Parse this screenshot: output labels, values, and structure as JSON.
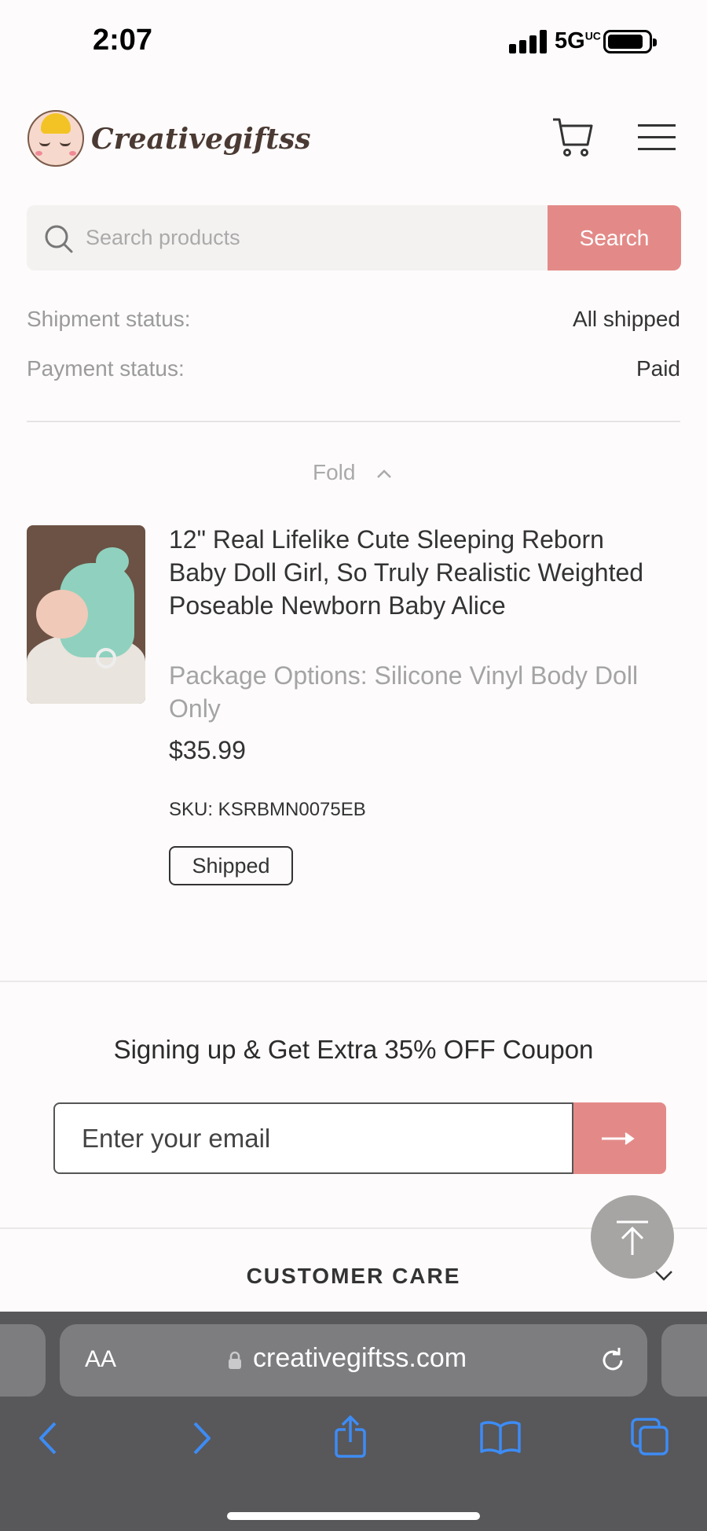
{
  "status_bar": {
    "time": "2:07",
    "network": "5G",
    "network_sup": "UC"
  },
  "header": {
    "logo_text": "Creativegiftss"
  },
  "search": {
    "placeholder": "Search products",
    "button_label": "Search"
  },
  "order_status": {
    "shipment_label": "Shipment status:",
    "shipment_value": "All shipped",
    "payment_label": "Payment status:",
    "payment_value": "Paid"
  },
  "fold_label": "Fold",
  "product": {
    "title": "12\" Real Lifelike Cute Sleeping Reborn Baby Doll Girl, So Truly Realistic Weighted Poseable Newborn Baby Alice",
    "option": "Package Options: Silicone Vinyl Body Doll Only",
    "price": "$35.99",
    "sku": "SKU: KSRBMN0075EB",
    "status_badge": "Shipped"
  },
  "newsletter": {
    "title": "Signing up & Get Extra 35% OFF Coupon",
    "email_placeholder": "Enter your email"
  },
  "footer": {
    "customer_care": "CUSTOMER CARE"
  },
  "browser": {
    "aa_label": "AA",
    "url": "creativegiftss.com"
  },
  "colors": {
    "accent": "#e38a88",
    "browser_bar": "#58575a",
    "nav_icon": "#3d8cf5"
  },
  "icons": [
    "search-icon",
    "cart-icon",
    "menu-icon",
    "chevron-up-icon",
    "arrow-right-icon",
    "arrow-up-icon",
    "chevron-down-icon",
    "lock-icon",
    "reload-icon",
    "back-icon",
    "forward-icon",
    "share-icon",
    "bookmarks-icon",
    "tabs-icon"
  ]
}
